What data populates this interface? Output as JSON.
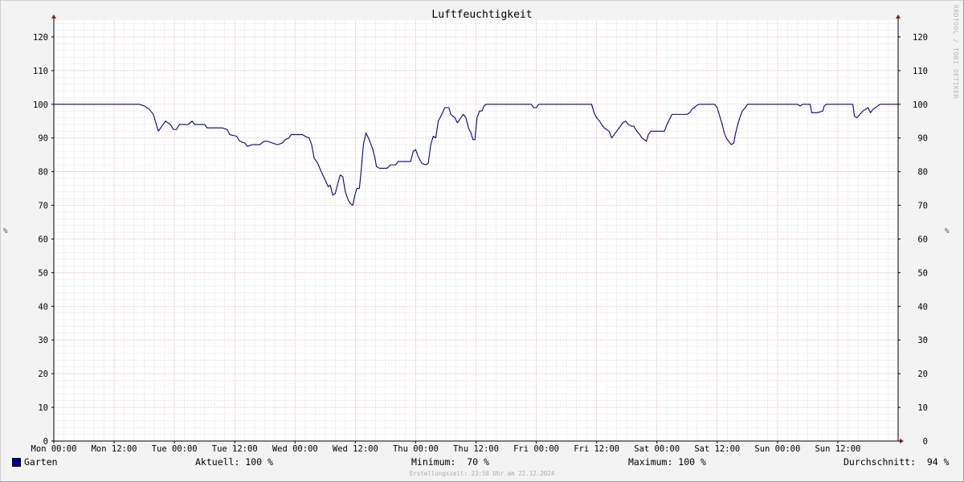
{
  "chart_data": {
    "type": "line",
    "title": "Luftfeuchtigkeit",
    "ylabel": "%",
    "ylim": [
      0,
      125
    ],
    "yticks": [
      0,
      10,
      20,
      30,
      40,
      50,
      60,
      70,
      80,
      90,
      100,
      110,
      120
    ],
    "x_unit": "hours since Mon 00:00",
    "xlim": [
      0,
      168
    ],
    "xtick_labels": [
      "Mon 00:00",
      "Mon 12:00",
      "Tue 00:00",
      "Tue 12:00",
      "Wed 00:00",
      "Wed 12:00",
      "Thu 00:00",
      "Thu 12:00",
      "Fri 00:00",
      "Fri 12:00",
      "Sat 00:00",
      "Sat 12:00",
      "Sun 00:00",
      "Sun 12:00"
    ],
    "grid": true,
    "series": [
      {
        "name": "Garten",
        "color": "#00008b",
        "points": [
          [
            0,
            100
          ],
          [
            17,
            100
          ],
          [
            18,
            99.5
          ],
          [
            19,
            98.5
          ],
          [
            19.8,
            97
          ],
          [
            20.3,
            94.5
          ],
          [
            20.8,
            92
          ],
          [
            21.5,
            93.5
          ],
          [
            22.2,
            95
          ],
          [
            23.2,
            94
          ],
          [
            23.8,
            92.5
          ],
          [
            24.4,
            92.5
          ],
          [
            25,
            94
          ],
          [
            26.8,
            94
          ],
          [
            27.5,
            95
          ],
          [
            28,
            94
          ],
          [
            30,
            94
          ],
          [
            30.5,
            93
          ],
          [
            33.5,
            93
          ],
          [
            34.5,
            92.5
          ],
          [
            35,
            91
          ],
          [
            36.4,
            90.5
          ],
          [
            37,
            89
          ],
          [
            38,
            88.5
          ],
          [
            38.5,
            87.5
          ],
          [
            39.5,
            88
          ],
          [
            41,
            88
          ],
          [
            41.8,
            89
          ],
          [
            42.5,
            89
          ],
          [
            43.5,
            88.5
          ],
          [
            44.5,
            88
          ],
          [
            45.5,
            88.5
          ],
          [
            46,
            89.5
          ],
          [
            46.8,
            90
          ],
          [
            47.2,
            91
          ],
          [
            49.5,
            91
          ],
          [
            50,
            90.5
          ],
          [
            50.8,
            90
          ],
          [
            51.3,
            88
          ],
          [
            51.8,
            84
          ],
          [
            52.5,
            82.5
          ],
          [
            53.2,
            80
          ],
          [
            54,
            77.5
          ],
          [
            54.6,
            75.5
          ],
          [
            55,
            76
          ],
          [
            55.5,
            73
          ],
          [
            56,
            73.5
          ],
          [
            56.6,
            77
          ],
          [
            57,
            79
          ],
          [
            57.5,
            78.5
          ],
          [
            58,
            74
          ],
          [
            58.6,
            71.5
          ],
          [
            59,
            70.5
          ],
          [
            59.5,
            70
          ],
          [
            59.9,
            73
          ],
          [
            60.3,
            75
          ],
          [
            60.8,
            75
          ],
          [
            61.2,
            81
          ],
          [
            61.6,
            88
          ],
          [
            62.1,
            91.5
          ],
          [
            62.6,
            90
          ],
          [
            63,
            88.5
          ],
          [
            63.5,
            86.5
          ],
          [
            63.9,
            84
          ],
          [
            64.2,
            81.5
          ],
          [
            64.8,
            81
          ],
          [
            66.3,
            81
          ],
          [
            67,
            82
          ],
          [
            68,
            82
          ],
          [
            68.5,
            83
          ],
          [
            71,
            83
          ],
          [
            71.5,
            86
          ],
          [
            72,
            86.5
          ],
          [
            72.5,
            84.5
          ],
          [
            73.2,
            82.5
          ],
          [
            74,
            82
          ],
          [
            74.5,
            82.5
          ],
          [
            75,
            88
          ],
          [
            75.5,
            90.5
          ],
          [
            76,
            90
          ],
          [
            76.5,
            95
          ],
          [
            77.2,
            97
          ],
          [
            77.8,
            99
          ],
          [
            78.6,
            99
          ],
          [
            79,
            97
          ],
          [
            79.8,
            96
          ],
          [
            80.3,
            94.5
          ],
          [
            81,
            96
          ],
          [
            81.5,
            97
          ],
          [
            82,
            96
          ],
          [
            82.5,
            93
          ],
          [
            83,
            91.5
          ],
          [
            83.4,
            89.5
          ],
          [
            83.8,
            89.5
          ],
          [
            84.2,
            96
          ],
          [
            84.7,
            98
          ],
          [
            85.2,
            98
          ],
          [
            85.6,
            99.5
          ],
          [
            86,
            100
          ],
          [
            95,
            100
          ],
          [
            95.5,
            99
          ],
          [
            96,
            99
          ],
          [
            96.5,
            100
          ],
          [
            107,
            100
          ],
          [
            107.5,
            97.5
          ],
          [
            108,
            96
          ],
          [
            108.6,
            95
          ],
          [
            109,
            94
          ],
          [
            109.5,
            93
          ],
          [
            110,
            92.5
          ],
          [
            110.5,
            92
          ],
          [
            111,
            90
          ],
          [
            111.5,
            91
          ],
          [
            112,
            92
          ],
          [
            112.5,
            93
          ],
          [
            113.2,
            94.5
          ],
          [
            113.8,
            95
          ],
          [
            114.3,
            94
          ],
          [
            114.9,
            93.5
          ],
          [
            115.4,
            93.5
          ],
          [
            116,
            92
          ],
          [
            116.6,
            91
          ],
          [
            117,
            90
          ],
          [
            117.5,
            89.5
          ],
          [
            117.9,
            89
          ],
          [
            118.3,
            91
          ],
          [
            118.8,
            92
          ],
          [
            121.5,
            92
          ],
          [
            122,
            94
          ],
          [
            122.5,
            95.5
          ],
          [
            123,
            97
          ],
          [
            126,
            97
          ],
          [
            126.5,
            97.5
          ],
          [
            127,
            98.5
          ],
          [
            127.8,
            99.5
          ],
          [
            128.3,
            100
          ],
          [
            131.5,
            100
          ],
          [
            132,
            99
          ],
          [
            132.4,
            97
          ],
          [
            133,
            94
          ],
          [
            133.4,
            91.5
          ],
          [
            133.8,
            90
          ],
          [
            134.3,
            89
          ],
          [
            134.8,
            88
          ],
          [
            135.3,
            88.5
          ],
          [
            135.6,
            91
          ],
          [
            136,
            93.5
          ],
          [
            136.5,
            96
          ],
          [
            137,
            98
          ],
          [
            137.6,
            99
          ],
          [
            138,
            100
          ],
          [
            148,
            100
          ],
          [
            148.5,
            99.5
          ],
          [
            149,
            100
          ],
          [
            150.5,
            100
          ],
          [
            150.8,
            97.5
          ],
          [
            152,
            97.5
          ],
          [
            153,
            98
          ],
          [
            153.3,
            99.5
          ],
          [
            153.7,
            100
          ],
          [
            159,
            100
          ],
          [
            159.3,
            96.5
          ],
          [
            159.8,
            96
          ],
          [
            160.4,
            97
          ],
          [
            161,
            98
          ],
          [
            161.5,
            98.5
          ],
          [
            162,
            99
          ],
          [
            162.5,
            97.5
          ],
          [
            163,
            98.5
          ],
          [
            163.5,
            99
          ],
          [
            164.4,
            100
          ],
          [
            168,
            100
          ]
        ]
      }
    ]
  },
  "side_label": "RRDTOOL / TOBI OETIKER",
  "legend": {
    "series_name": "Garten",
    "color": "#00008b",
    "current": "Aktuell: 100 %",
    "minimum": "Minimum:  70 %",
    "maximum": "Maximum: 100 %",
    "average": "Durchschnitt:  94 %"
  },
  "footer": "Erstellungszeit: 23:58 Uhr am 22.12.2024"
}
